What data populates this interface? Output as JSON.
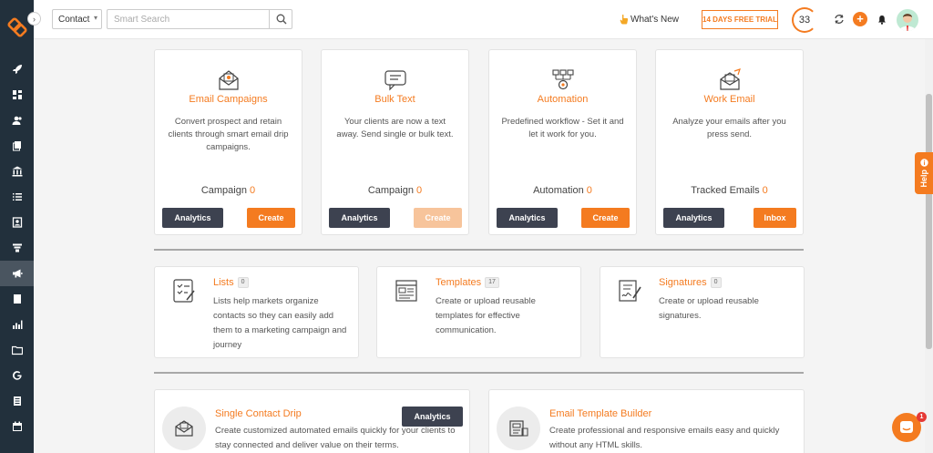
{
  "topbar": {
    "contact_select": "Contact",
    "search_placeholder": "Smart Search",
    "whats_new": "What's New",
    "trial": "14 DAYS FREE TRIAL",
    "counter": "33",
    "plus": "+"
  },
  "help": "Help",
  "chat_badge": "1",
  "icons": {
    "sidebar": [
      "rocket-icon",
      "dashboard-icon",
      "contacts-icon",
      "documents-icon",
      "bank-icon",
      "list-icon",
      "contact-card-icon",
      "funnel-icon",
      "megaphone-icon",
      "page-icon",
      "bar-chart-icon",
      "folder-icon",
      "google-icon",
      "report-icon",
      "calendar-icon"
    ]
  },
  "top_cards": [
    {
      "title": "Email Campaigns",
      "desc": "Convert prospect and retain clients through smart email drip campaigns.",
      "count_label": "Campaign",
      "count": "0",
      "btn1": "Analytics",
      "btn2": "Create"
    },
    {
      "title": "Bulk Text",
      "desc": "Your clients are now a text away. Send single or bulk text.",
      "count_label": "Campaign",
      "count": "0",
      "btn1": "Analytics",
      "btn2": "Create"
    },
    {
      "title": "Automation",
      "desc": "Predefined workflow - Set it and let it work for you.",
      "count_label": "Automation",
      "count": "0",
      "btn1": "Analytics",
      "btn2": "Create"
    },
    {
      "title": "Work Email",
      "desc": "Analyze your emails after you press send.",
      "count_label": "Tracked Emails",
      "count": "0",
      "btn1": "Analytics",
      "btn2": "Inbox"
    }
  ],
  "mid_cards": [
    {
      "title": "Lists",
      "badge": "0",
      "desc": "Lists help markets organize contacts so they can easily add them to a marketing campaign and journey"
    },
    {
      "title": "Templates",
      "badge": "17",
      "desc": "Create or upload reusable templates for effective communication."
    },
    {
      "title": "Signatures",
      "badge": "0",
      "desc": "Create or upload reusable signatures."
    }
  ],
  "bottom_cards": [
    {
      "title": "Single Contact Drip",
      "desc": "Create customized automated emails quickly for your clients to stay connected and deliver value on their terms.",
      "btn": "Analytics"
    },
    {
      "title": "Email Template Builder",
      "desc": "Create professional and responsive emails easy and quickly without any HTML skills."
    }
  ]
}
